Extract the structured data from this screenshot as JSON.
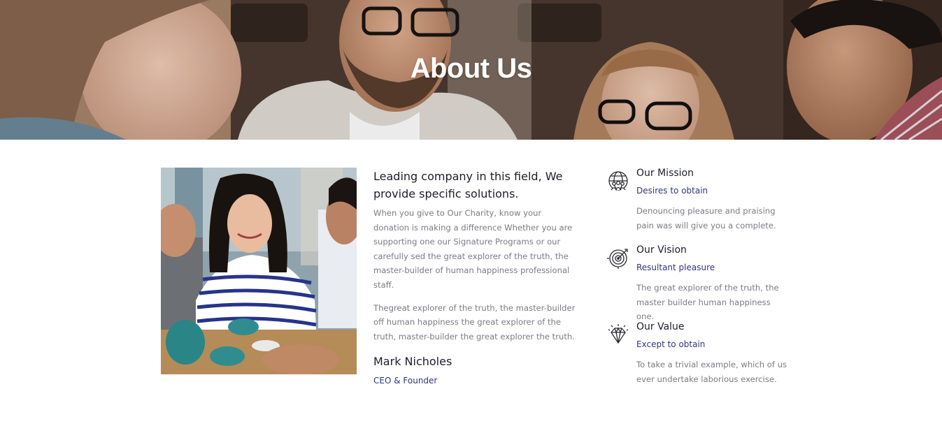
{
  "hero": {
    "title": "About Us"
  },
  "intro": {
    "heading": "Leading company in this field, We provide specific solutions.",
    "paragraphs": [
      "When you give to Our Charity, know your donation is making a difference Whether you are supporting one our Signature Programs or our carefully sed the great explorer of the truth, the master-builder of human happiness professional staff.",
      "Thegreat explorer of the truth, the master-builder off human happiness the great explorer of the truth, master-builder the great explorer the truth."
    ],
    "founder_name": "Mark Nicholes",
    "founder_role": "CEO & Founder"
  },
  "features": [
    {
      "icon": "globe-people-icon",
      "title": "Our Mission",
      "subtitle": "Desires to obtain",
      "text": "Denouncing pleasure and praising pain was will give you a complete."
    },
    {
      "icon": "target-icon",
      "title": "Our Vision",
      "subtitle": "Resultant pleasure",
      "text": "The great explorer of the truth, the master builder human happiness one."
    },
    {
      "icon": "diamond-icon",
      "title": "Our Value",
      "subtitle": "Except to obtain",
      "text": "To take a trivial example, which of us ever undertake laborious exercise."
    }
  ],
  "colors": {
    "heading": "#1d1d2b",
    "body_text": "#7b7b86",
    "accent_link": "#2f3580",
    "hero_title": "#ffffff"
  }
}
